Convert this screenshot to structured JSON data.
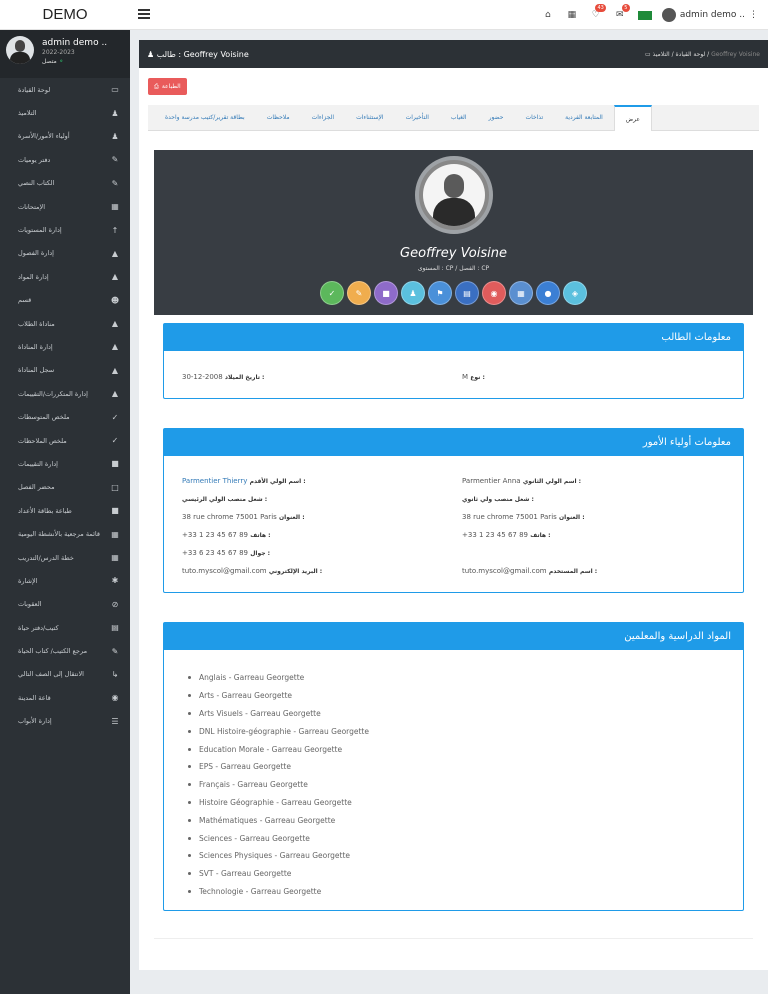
{
  "brand": "DEMO",
  "topbar": {
    "user": "admin demo ..",
    "bell_count": "43",
    "mail_count": "5"
  },
  "sidebar": {
    "user_name": "admin demo ..",
    "year": "2022-2023",
    "status": "متصل",
    "items": [
      {
        "label": "لوحة القيادة",
        "icon": "laptop-icon"
      },
      {
        "label": "التلاميذ",
        "icon": "user-icon"
      },
      {
        "label": "أولياء الأمور/الأسرة",
        "icon": "user-icon"
      },
      {
        "label": "دفتر يوميات",
        "icon": "edit-icon"
      },
      {
        "label": "الكتاب النصي",
        "icon": "edit-icon"
      },
      {
        "label": "الإمتحانات",
        "icon": "table-icon"
      },
      {
        "label": "إدارة المستويات",
        "icon": "level-icon"
      },
      {
        "label": "إدارة الفصول",
        "icon": "sitemap-icon"
      },
      {
        "label": "إدارة المواد",
        "icon": "sitemap-icon"
      },
      {
        "label": "قسم",
        "icon": "users-icon"
      },
      {
        "label": "مناداة الطلاب",
        "icon": "building-icon"
      },
      {
        "label": "إدارة المناداة",
        "icon": "building-icon"
      },
      {
        "label": "سجل المناداة",
        "icon": "building-icon"
      },
      {
        "label": "إدارة المتكررات/التقييمات",
        "icon": "sitemap-icon"
      },
      {
        "label": "ملخص المتوسطات",
        "icon": "check-icon"
      },
      {
        "label": "ملخص الملاحظات",
        "icon": "check-icon"
      },
      {
        "label": "إدارة التقييمات",
        "icon": "file-icon"
      },
      {
        "label": "محضر الفصل",
        "icon": "file-o-icon"
      },
      {
        "label": "طباعة بطاقة الأعداد",
        "icon": "file-icon"
      },
      {
        "label": "قائمة مرجعية بالأنشطة اليومية",
        "icon": "table-icon"
      },
      {
        "label": "خطة الدرس/التدريب",
        "icon": "table-icon"
      },
      {
        "label": "الإشارة",
        "icon": "asterisk-icon"
      },
      {
        "label": "العقوبات",
        "icon": "ban-icon"
      },
      {
        "label": "كتيب/دفتر حياة",
        "icon": "book-icon",
        "chevron": true
      },
      {
        "label": "مرجع الكتيب/ كتاب الحياة",
        "icon": "edit-icon",
        "chevron": true
      },
      {
        "label": "الانتقال إلى الصف التالي",
        "icon": "level-down-icon"
      },
      {
        "label": "قاعة المدينة",
        "icon": "marker-icon"
      },
      {
        "label": "إدارة الأبواب",
        "icon": "list-icon"
      }
    ]
  },
  "header": {
    "title": "طالب : Geoffrey Voisine",
    "breadcrumb": [
      "لوحة القيادة",
      "التلاميذ",
      "Geoffrey Voisine"
    ]
  },
  "print_label": "الطباعة",
  "tabs": [
    "عرض",
    "المتابعة الفردية",
    "تذاخات",
    "حضور",
    "الغياب",
    "التأخيرات",
    "الإستثناءات",
    "الجزاءات",
    "ملاحظات",
    "بطاقة تقرير/كتيب مدرسة واحدة"
  ],
  "profile": {
    "name": "Geoffrey Voisine",
    "class_line": "المستوى : CP / الفصل : CP",
    "actions": [
      {
        "icon": "check-icon",
        "color": "#5cb85c"
      },
      {
        "icon": "edit-icon",
        "color": "#f0ad4e"
      },
      {
        "icon": "file-icon",
        "color": "#8e6bc9"
      },
      {
        "icon": "user-icon",
        "color": "#5bc0de"
      },
      {
        "icon": "flag-icon",
        "color": "#4a90d9"
      },
      {
        "icon": "document-icon",
        "color": "#3a6fc2"
      },
      {
        "icon": "eye-icon",
        "color": "#e05c5c"
      },
      {
        "icon": "calendar-icon",
        "color": "#5a8fd0"
      },
      {
        "icon": "comment-icon",
        "color": "#3b7fd4"
      },
      {
        "icon": "tag-icon",
        "color": "#5bc0de"
      }
    ]
  },
  "student_info": {
    "title": "معلومات الطالب",
    "birth_label": "تاريخ الميلاد :",
    "birth_value": "30-12-2008",
    "gender_label": "نوع :",
    "gender_value": "M"
  },
  "parents_info": {
    "title": "معلومات أولياء الأمور",
    "primary_name_label": "اسم الولي الأقدم :",
    "primary_name": "Parmentier Thierry",
    "primary_job_label": "شغل منصب الولي الرئيسي :",
    "primary_address_label": "العنوان :",
    "primary_address": "38 rue chrome 75001 Paris",
    "primary_phone_label": "هاتف :",
    "primary_phone": "+33 1 23 45 67 89",
    "primary_mobile_label": "جوال :",
    "primary_mobile": "+33 6 23 45 67 89",
    "primary_email_label": "البريد الإلكتروني :",
    "primary_email": "tuto.myscol@gmail.com",
    "secondary_name_label": "اسم الولي الثانوي :",
    "secondary_name": "Parmentier Anna",
    "secondary_job_label": "شغل منصب ولي ثانوي :",
    "secondary_address_label": "العنوان :",
    "secondary_address": "38 rue chrome 75001 Paris",
    "secondary_phone_label": "هاتف :",
    "secondary_phone": "+33 1 23 45 67 89",
    "secondary_user_label": "اسم المستخدم :",
    "secondary_user": "tuto.myscol@gmail.com"
  },
  "subjects": {
    "title": "المواد الدراسية والمعلمين",
    "items": [
      "Anglais - Garreau Georgette",
      "Arts - Garreau Georgette",
      "Arts Visuels - Garreau Georgette",
      "DNL Histoire-géographie - Garreau Georgette",
      "Education Morale - Garreau Georgette",
      "EPS - Garreau Georgette",
      "Français - Garreau Georgette",
      "Histoire Géographie - Garreau Georgette",
      "Mathématiques - Garreau Georgette",
      "Sciences - Garreau Georgette",
      "Sciences Physiques - Garreau Georgette",
      "SVT - Garreau Georgette",
      "Technologie - Garreau Georgette"
    ]
  }
}
